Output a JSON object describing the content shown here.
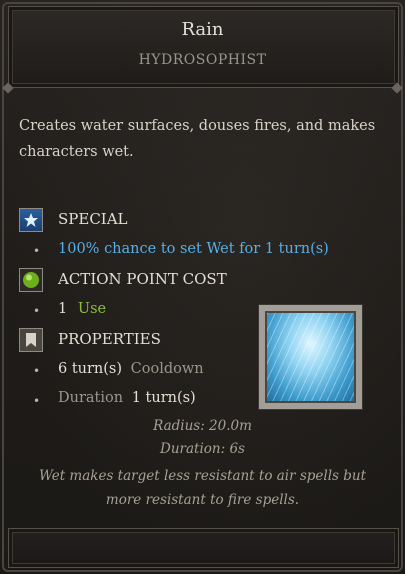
{
  "header": {
    "title": "Rain",
    "subtitle": "HYDROSOPHIST"
  },
  "description": "Creates water surfaces, douses fires, and makes characters wet.",
  "sections": {
    "special": {
      "label": "SPECIAL",
      "icon": "star-icon",
      "item": "100% chance to set Wet for 1 turn(s)"
    },
    "action_point_cost": {
      "label": "ACTION POINT COST",
      "icon": "green-orb-icon",
      "value": "1",
      "unit": "Use"
    },
    "properties": {
      "label": "PROPERTIES",
      "icon": "bookmark-icon",
      "cooldown_value": "6 turn(s)",
      "cooldown_label": "Cooldown",
      "duration_label": "Duration",
      "duration_value": "1 turn(s)"
    }
  },
  "details": {
    "radius": "Radius: 20.0m",
    "duration": "Duration: 6s",
    "status_text": "Wet makes target less resistant to air spells but more resistant to fire spells."
  },
  "colors": {
    "special_text": "#58aee6",
    "action_value": "#8dbf3a",
    "background": "#1f1c19"
  }
}
